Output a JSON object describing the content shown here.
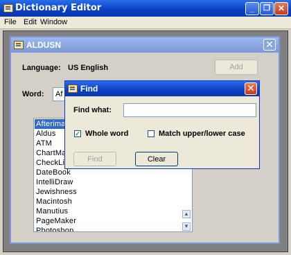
{
  "app": {
    "title": "Dictionary Editor",
    "window_buttons": {
      "minimize": "_",
      "restore": "❐",
      "close": "✕"
    }
  },
  "menu": {
    "items": [
      "File",
      "Edit",
      "Window"
    ]
  },
  "child": {
    "title": "ALDUSN",
    "close": "✕",
    "language_label": "Language:",
    "language_value": "US English",
    "add_label": "Add",
    "word_label": "Word:",
    "word_value": "Af",
    "words": [
      "Afterima",
      "Aldus",
      "ATM",
      "ChartMa",
      "CheckLis",
      "DateBook",
      "IntelliDraw",
      "Jewishness",
      "Macintosh",
      "Manutius",
      "PageMaker",
      "Photoshop"
    ],
    "selected_index": 0
  },
  "find": {
    "title": "Find",
    "close": "✕",
    "find_label": "Find what:",
    "find_value": "",
    "whole_word_label": "Whole word",
    "whole_word_checked": true,
    "match_case_label": "Match upper/lower case",
    "match_case_checked": false,
    "find_button": "Find",
    "clear_button": "Clear"
  },
  "colors": {
    "titlebar": "#0a3fc4",
    "selection": "#316ac5",
    "face": "#d4d0c8"
  }
}
